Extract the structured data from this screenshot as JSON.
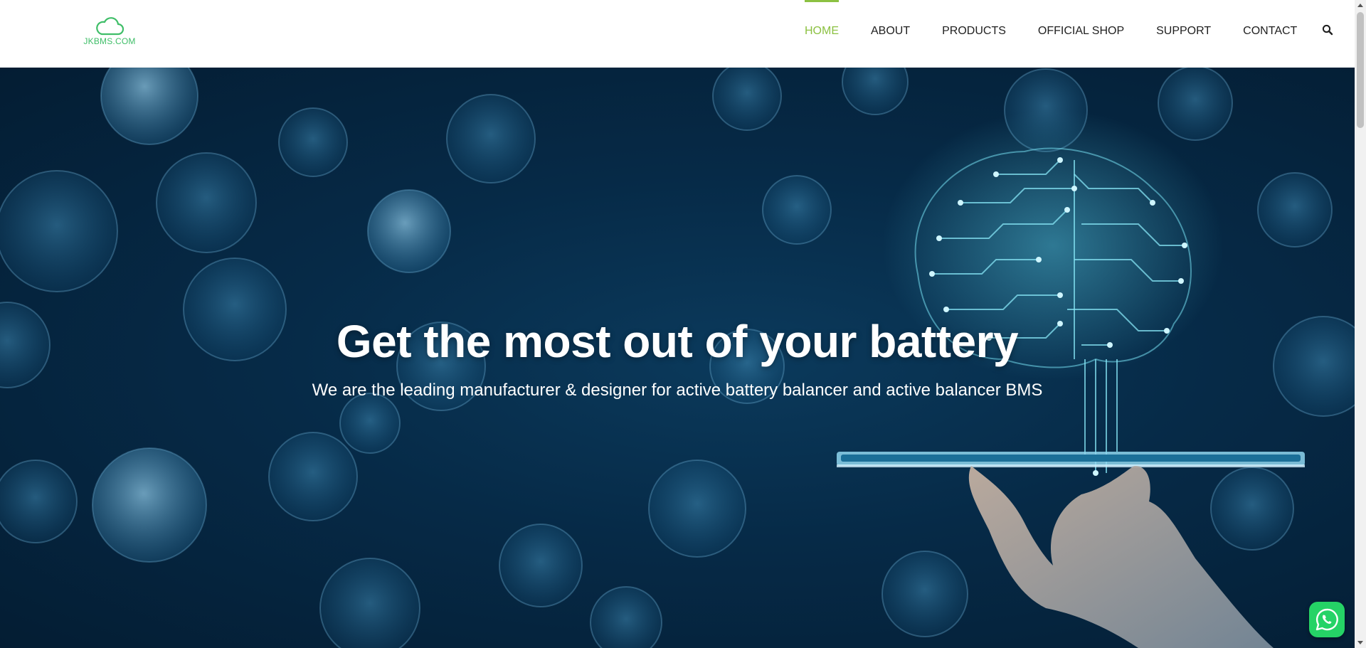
{
  "header": {
    "logo_text": "JKBMS.COM",
    "nav": [
      {
        "label": "HOME",
        "active": true
      },
      {
        "label": "ABOUT",
        "active": false
      },
      {
        "label": "PRODUCTS",
        "active": false
      },
      {
        "label": "OFFICIAL SHOP",
        "active": false
      },
      {
        "label": "SUPPORT",
        "active": false
      },
      {
        "label": "CONTACT",
        "active": false
      }
    ],
    "search_icon": "search-icon"
  },
  "hero": {
    "title": "Get the most out of your battery",
    "subtitle": "We are the leading manufacturer & designer for active battery balancer and active balancer BMS"
  },
  "widgets": {
    "whatsapp_icon": "whatsapp-icon"
  },
  "colors": {
    "accent": "#8cc142",
    "logo": "#3fbe68",
    "nav_text": "#1f1f1f",
    "hero_bg": "#062a47",
    "whatsapp": "#25d366"
  }
}
